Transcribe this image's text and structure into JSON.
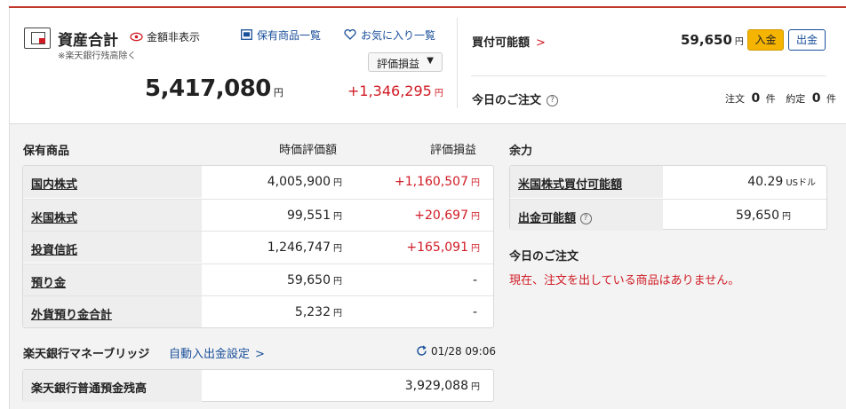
{
  "assets": {
    "title": "資産合計",
    "hide_label": "金額非表示",
    "note": "※楽天銀行残高除く",
    "holdings_link": "保有商品一覧",
    "favorites_link": "お気に入り一覧",
    "sort_label": "評価損益",
    "total_value": "5,417,080",
    "total_unit": "円",
    "total_pl": "+1,346,295",
    "pl_unit": "円"
  },
  "buying_power": {
    "label": "買付可能額",
    "value": "59,650",
    "unit": "円",
    "deposit_btn": "入金",
    "withdraw_btn": "出金"
  },
  "today_orders": {
    "label": "今日のご注文",
    "order_label": "注文",
    "order_count": "0",
    "exec_label": "約定",
    "exec_count": "0",
    "count_unit": "件"
  },
  "holdings": {
    "title": "保有商品",
    "col_value": "時価評価額",
    "col_pl": "評価損益",
    "rows": [
      {
        "name": "国内株式",
        "value": "4,005,900",
        "unit": "円",
        "pl": "+1,160,507",
        "pl_unit": "円"
      },
      {
        "name": "米国株式",
        "value": "99,551",
        "unit": "円",
        "pl": "+20,697",
        "pl_unit": "円"
      },
      {
        "name": "投資信託",
        "value": "1,246,747",
        "unit": "円",
        "pl": "+165,091",
        "pl_unit": "円"
      },
      {
        "name": "預り金",
        "value": "59,650",
        "unit": "円",
        "pl": "-",
        "pl_unit": ""
      },
      {
        "name": "外貨預り金合計",
        "value": "5,232",
        "unit": "円",
        "pl": "-",
        "pl_unit": ""
      }
    ]
  },
  "bank": {
    "title": "楽天銀行マネーブリッジ",
    "auto_link": "自動入出金設定",
    "timestamp": "01/28 09:06",
    "row_label": "楽天銀行普通預金残高",
    "row_value": "3,929,088",
    "row_unit": "円"
  },
  "margin": {
    "title": "余力",
    "rows": [
      {
        "name": "米国株式買付可能額",
        "value": "40.29",
        "unit": "USドル"
      },
      {
        "name": "出金可能額",
        "value": "59,650",
        "unit": "円"
      }
    ],
    "orders_title": "今日のご注文",
    "no_orders": "現在、注文を出している商品はありません。"
  },
  "colors": {
    "accent_red": "#d01b24",
    "link_blue": "#1a4f9a",
    "deposit_yellow": "#f5b400"
  }
}
